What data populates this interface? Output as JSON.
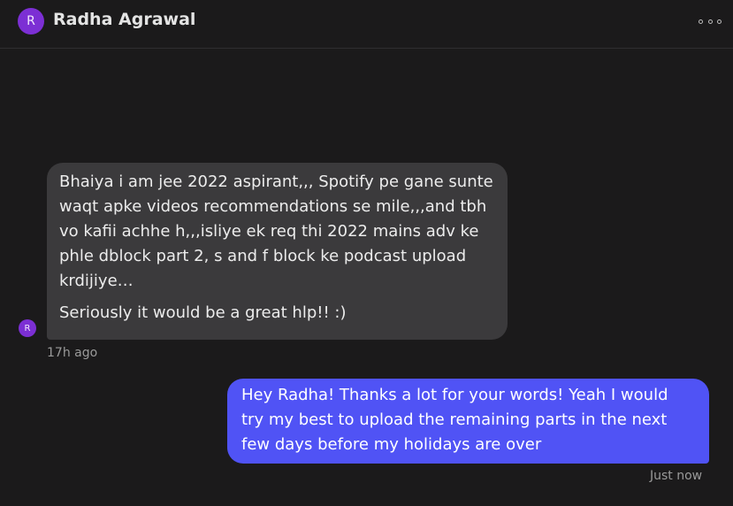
{
  "contact": {
    "initial": "R",
    "name": "Radha Agrawal"
  },
  "header": {
    "menu_icon": "more-options-icon"
  },
  "messages": [
    {
      "direction": "incoming",
      "paragraphs": [
        "Bhaiya i am jee 2022 aspirant,,, Spotify pe gane sunte waqt apke videos recommendations se mile,,,and tbh vo kafii achhe h,,,isliye ek req thi 2022 mains adv ke phle dblock part 2, s and f block ke podcast upload krdijiye…",
        "Seriously it would be a great hlp!! :)"
      ],
      "timestamp": "17h ago"
    },
    {
      "direction": "outgoing",
      "text": "Hey Radha! Thanks a lot for your words! Yeah I would try my best to upload the remaining parts in the next few days before my holidays are over",
      "timestamp": "Just now"
    }
  ],
  "colors": {
    "background": "#1b1a1b",
    "incoming_bubble": "#3b3a3c",
    "outgoing_bubble": "#5053f5",
    "avatar": "#7c2fd4"
  }
}
